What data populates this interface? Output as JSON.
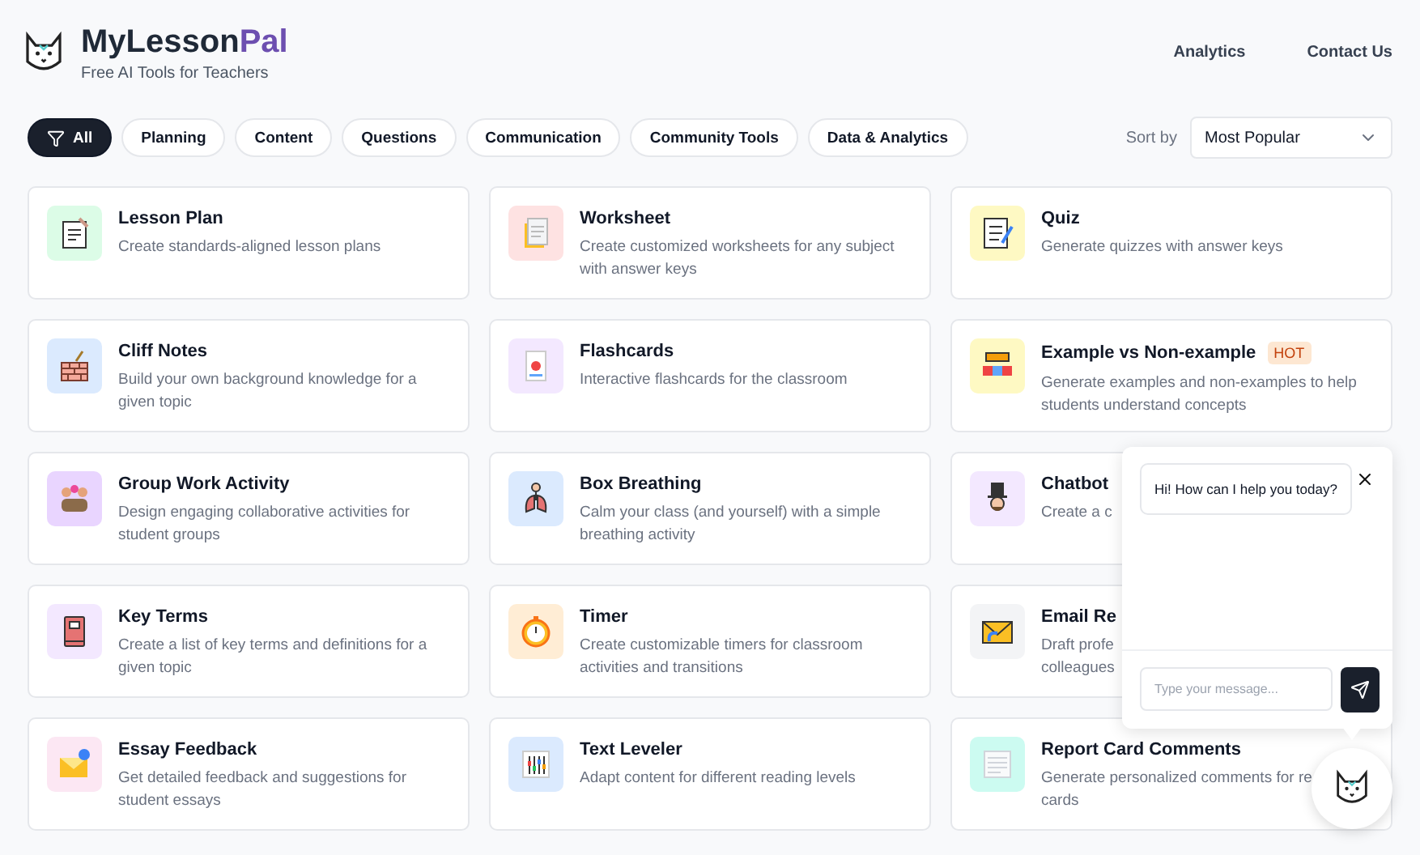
{
  "header": {
    "logo": {
      "text": "MyLesson",
      "accent": "Pal"
    },
    "tagline": "Free AI Tools for Teachers",
    "nav": [
      "Analytics",
      "Contact Us"
    ]
  },
  "filters": [
    {
      "label": "All",
      "selected": true
    },
    {
      "label": "Planning",
      "selected": false
    },
    {
      "label": "Content",
      "selected": false
    },
    {
      "label": "Questions",
      "selected": false
    },
    {
      "label": "Communication",
      "selected": false
    },
    {
      "label": "Community Tools",
      "selected": false
    },
    {
      "label": "Data & Analytics",
      "selected": false
    }
  ],
  "sort": {
    "label": "Sort by",
    "value": "Most Popular"
  },
  "tools": [
    {
      "title": "Lesson Plan",
      "description": "Create standards-aligned lesson plans",
      "color": "#dcfce7"
    },
    {
      "title": "Worksheet",
      "description": "Create customized worksheets for any subject with answer keys",
      "color": "#fee2e2"
    },
    {
      "title": "Quiz",
      "description": "Generate quizzes with answer keys",
      "color": "#fef9c3"
    },
    {
      "title": "Cliff Notes",
      "description": "Build your own background knowledge for a given topic",
      "color": "#dbeafe"
    },
    {
      "title": "Flashcards",
      "description": "Interactive flashcards for the classroom",
      "color": "#f3e8ff"
    },
    {
      "title": "Example vs Non-example",
      "description": "Generate examples and non-examples to help students understand concepts",
      "color": "#fef9c3",
      "badge": "HOT"
    },
    {
      "title": "Group Work Activity",
      "description": "Design engaging collaborative activities for student groups",
      "color": "#e9d5ff"
    },
    {
      "title": "Box Breathing",
      "description": "Calm your class (and yourself) with a simple breathing activity",
      "color": "#dbeafe"
    },
    {
      "title": "Chatbot",
      "description": "Create a c",
      "color": "#f3e8ff"
    },
    {
      "title": "Key Terms",
      "description": "Create a list of key terms and definitions for a given topic",
      "color": "#f3e8ff"
    },
    {
      "title": "Timer",
      "description": "Create customizable timers for classroom activities and transitions",
      "color": "#ffedd5"
    },
    {
      "title": "Email Re",
      "description": "Draft profe\ncolleagues",
      "color": "#f3f4f6"
    },
    {
      "title": "Essay Feedback",
      "description": "Get detailed feedback and suggestions for student essays",
      "color": "#fce7f3"
    },
    {
      "title": "Text Leveler",
      "description": "Adapt content for different reading levels",
      "color": "#dbeafe"
    },
    {
      "title": "Report Card Comments",
      "description": "Generate personalized comments for re\ncards",
      "color": "#ccfbf1"
    }
  ],
  "chat": {
    "message": "Hi! How can I help you today?",
    "placeholder": "Type your message..."
  }
}
